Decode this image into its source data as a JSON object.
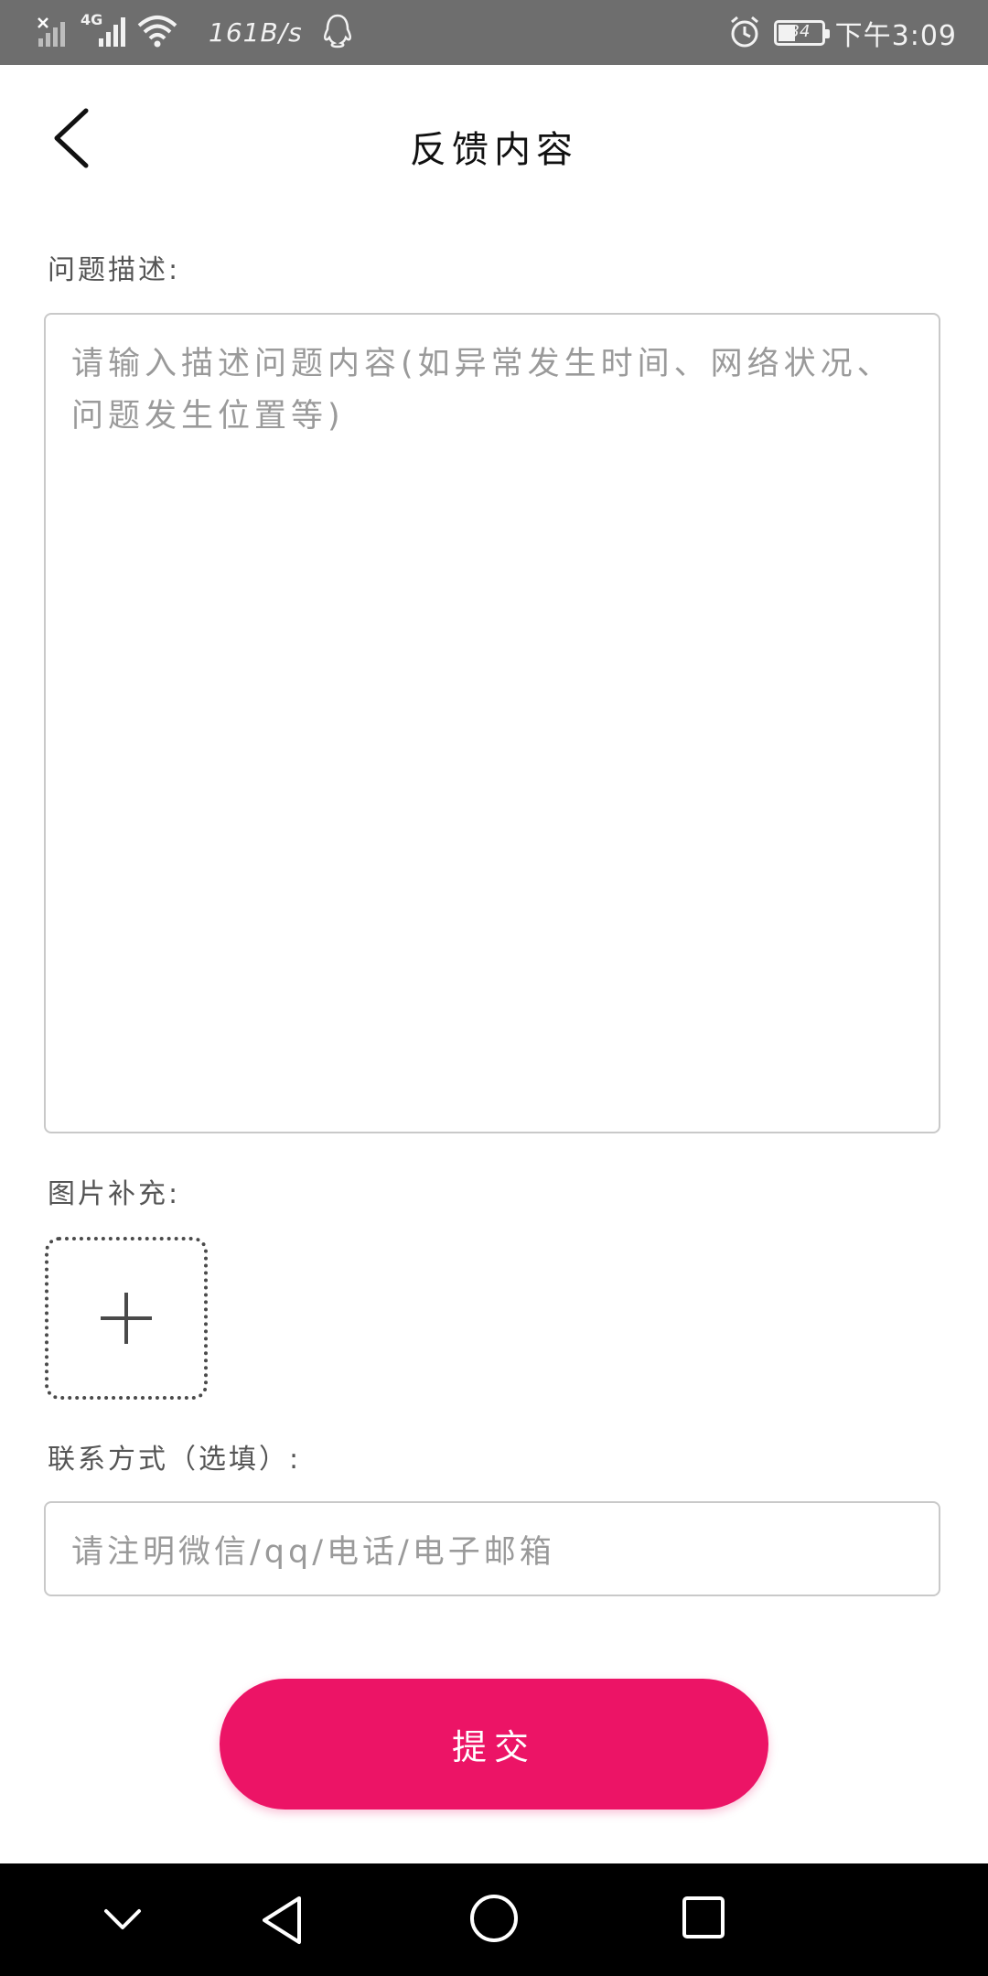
{
  "status_bar": {
    "network_label": "4G",
    "net_speed": "161B/s",
    "battery_level": "34",
    "time": "下午3:09",
    "icons": [
      "no-sim-signal-icon",
      "signal-icon",
      "wifi-icon",
      "qq-icon",
      "alarm-icon",
      "battery-icon"
    ]
  },
  "header": {
    "title": "反馈内容",
    "back_icon": "chevron-left-icon"
  },
  "form": {
    "description_label": "问题描述:",
    "description_placeholder": "请输入描述问题内容(如异常发生时间、网络状况、问题发生位置等)",
    "images_label": "图片补充:",
    "add_image_icon": "plus-icon",
    "contact_label": "联系方式（选填）:",
    "contact_placeholder": "请注明微信/qq/电话/电子邮箱",
    "submit_label": "提交"
  },
  "nav_bar": {
    "icons": [
      "chevron-down-icon",
      "back-triangle-icon",
      "home-circle-icon",
      "recents-square-icon"
    ]
  },
  "colors": {
    "accent": "#ec1466",
    "status_bar": "#6e6e6e",
    "nav_bar": "#000000",
    "placeholder": "#9a9a9a",
    "border": "#c9c9c9"
  }
}
